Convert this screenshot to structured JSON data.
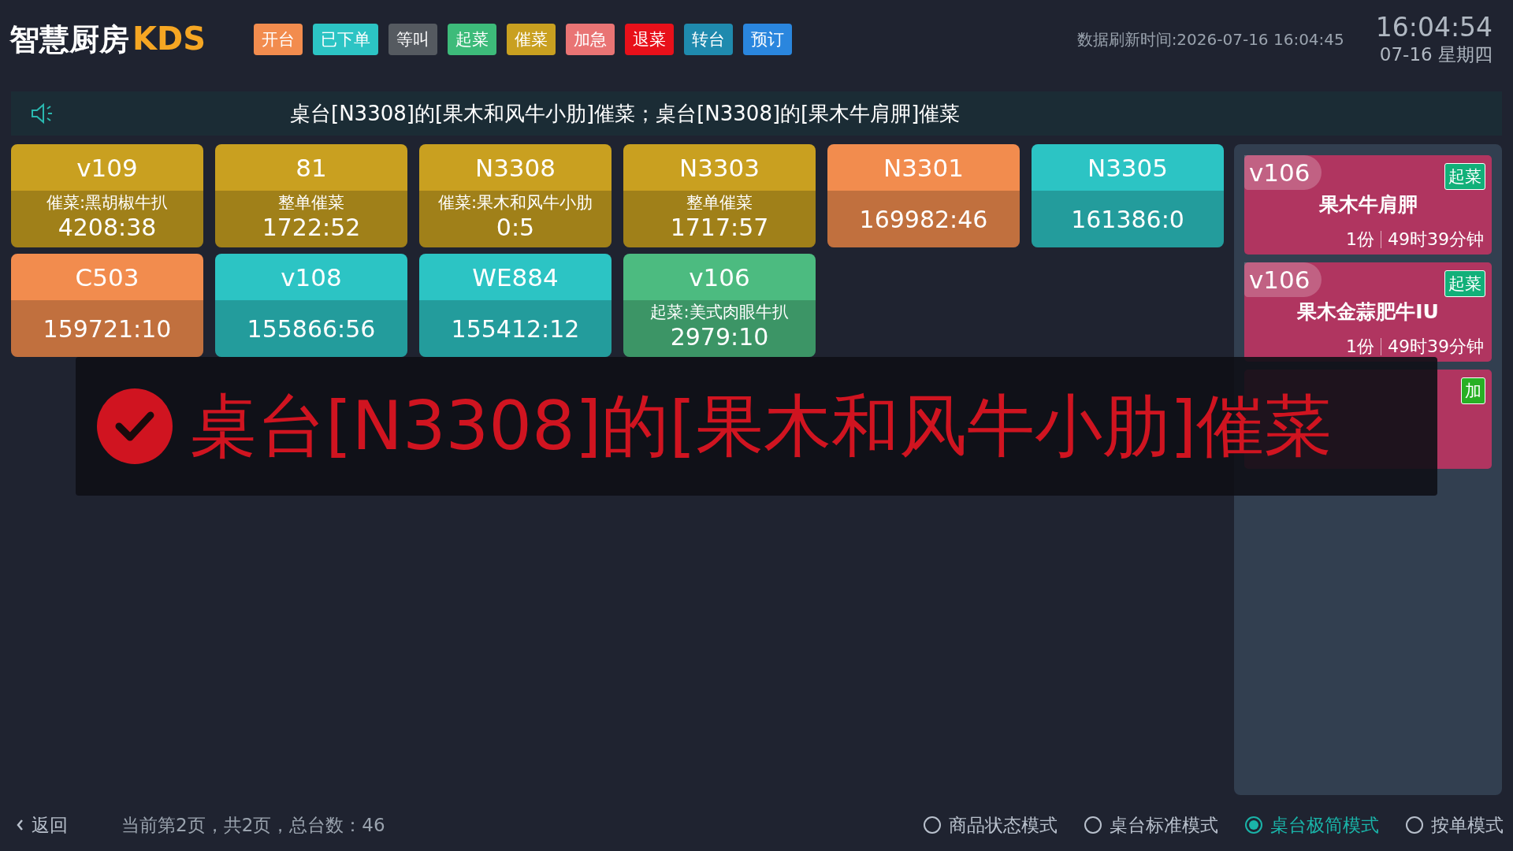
{
  "header": {
    "logo_text": "智慧厨房",
    "logo_accent": "KDS",
    "legend": [
      {
        "label": "开台",
        "color": "#f28c4e"
      },
      {
        "label": "已下单",
        "color": "#2cc4c4"
      },
      {
        "label": "等叫",
        "color": "#555a60"
      },
      {
        "label": "起菜",
        "color": "#3dbb7a"
      },
      {
        "label": "催菜",
        "color": "#c9a020"
      },
      {
        "label": "加急",
        "color": "#e97474"
      },
      {
        "label": "退菜",
        "color": "#e8101a"
      },
      {
        "label": "转台",
        "color": "#1f8aae"
      },
      {
        "label": "预订",
        "color": "#2a86de"
      }
    ],
    "refresh": "数据刷新时间:2026-07-16 16:04:45",
    "clock": "16:04:54",
    "date": "07-16 星期四"
  },
  "announcement": "桌台[N3308]的[果木和风牛小肋]催菜；桌台[N3308]的[果木牛肩胛]催菜",
  "tables": [
    {
      "name": "v109",
      "color": "#c9a020",
      "note": "催菜:黑胡椒牛扒",
      "time": "4208:38"
    },
    {
      "name": "81",
      "color": "#c9a020",
      "note": "整单催菜",
      "time": "1722:52"
    },
    {
      "name": "N3308",
      "color": "#c9a020",
      "note": "催菜:果木和风牛小肋",
      "time": "0:5"
    },
    {
      "name": "N3303",
      "color": "#c9a020",
      "note": "整单催菜",
      "time": "1717:57"
    },
    {
      "name": "N3301",
      "color": "#f28c4e",
      "time": "169982:46"
    },
    {
      "name": "N3305",
      "color": "#2cc4c4",
      "time": "161386:0"
    },
    {
      "name": "C503",
      "color": "#f28c4e",
      "time": "159721:10"
    },
    {
      "name": "v108",
      "color": "#2cc4c4",
      "time": "155866:56"
    },
    {
      "name": "WE884",
      "color": "#2cc4c4",
      "time": "155412:12"
    },
    {
      "name": "v106",
      "color": "#4cbb80",
      "note": "起菜:美式肉眼牛扒",
      "time": "2979:10"
    }
  ],
  "dishes": [
    {
      "table": "v106",
      "tags": [
        {
          "label": "起菜",
          "kind": "serve"
        }
      ],
      "name": "果木牛肩胛",
      "qty": "1份",
      "duration": "49时39分钟"
    },
    {
      "table": "v106",
      "tags": [
        {
          "label": "起菜",
          "kind": "serve"
        }
      ],
      "name": "果木金蒜肥牛IU",
      "qty": "1份",
      "duration": "49时39分钟"
    },
    {
      "tags": [
        {
          "label": "加",
          "kind": "add"
        }
      ]
    }
  ],
  "toast": {
    "message": "桌台[N3308]的[果木和风牛小肋]催菜"
  },
  "footer": {
    "back": "返回",
    "page_info": "当前第2页，共2页，总台数：46",
    "modes": [
      {
        "label": "商品状态模式",
        "selected": false
      },
      {
        "label": "桌台标准模式",
        "selected": false
      },
      {
        "label": "桌台极简模式",
        "selected": true
      },
      {
        "label": "按单模式",
        "selected": false
      }
    ]
  }
}
